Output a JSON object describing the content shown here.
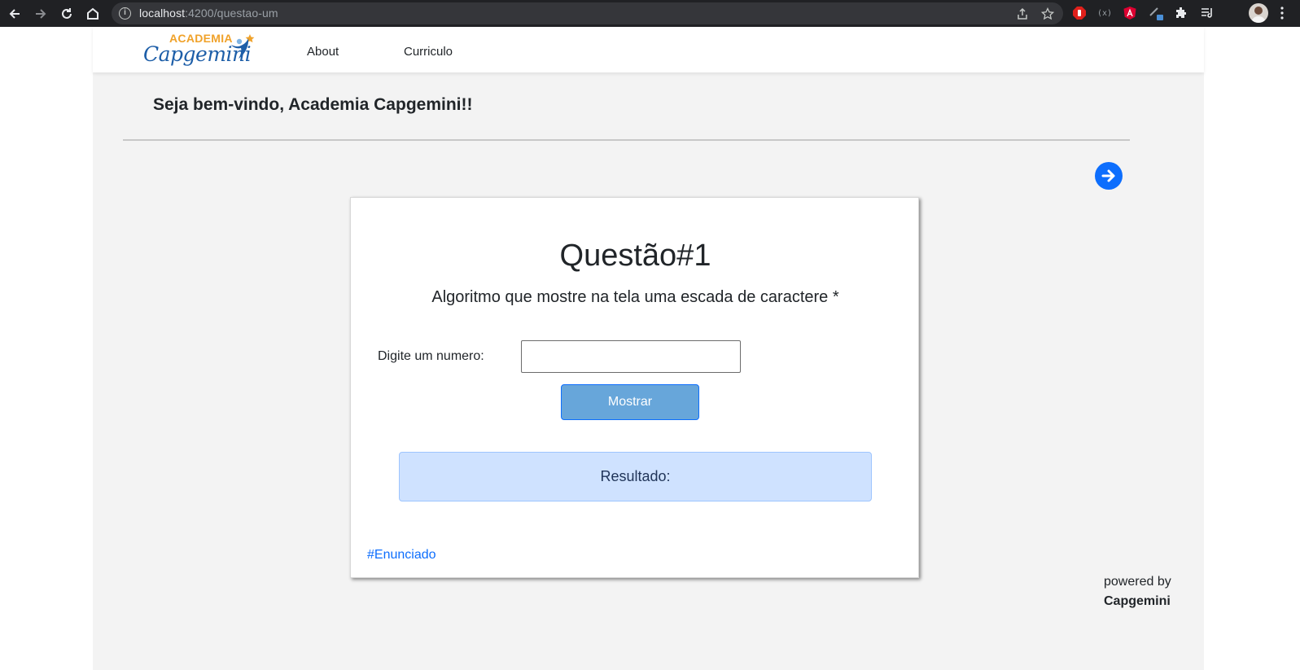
{
  "browser": {
    "url_host": "localhost",
    "url_rest": ":4200/questao-um",
    "icons": [
      "back-icon",
      "forward-icon",
      "reload-icon",
      "home-icon",
      "info-icon",
      "share-icon",
      "star-icon",
      "extensions-icon",
      "reading-list-icon",
      "profile-avatar",
      "menu-icon"
    ]
  },
  "navbar": {
    "logo_top": "ACADEMIA",
    "logo_main": "Capgemini",
    "links": [
      "About",
      "Curriculo"
    ]
  },
  "welcome": "Seja bem-vindo, Academia Capgemini!!",
  "card": {
    "title": "Questão#1",
    "subtitle": "Algoritmo que mostre na tela uma escada de caractere *",
    "input_label": "Digite um numero:",
    "input_value": "",
    "button_label": "Mostrar",
    "result_label": "Resultado:",
    "link_label": "#Enunciado"
  },
  "footer": {
    "powered_by": "powered by",
    "brand": "Capgemini"
  },
  "colors": {
    "primary": "#0d6efd",
    "button_bg": "#67a6da",
    "result_bg": "#cfe2ff",
    "logo_orange": "#f0a22a",
    "logo_blue": "#1d5ea8",
    "page_bg": "#f3f3f3"
  }
}
